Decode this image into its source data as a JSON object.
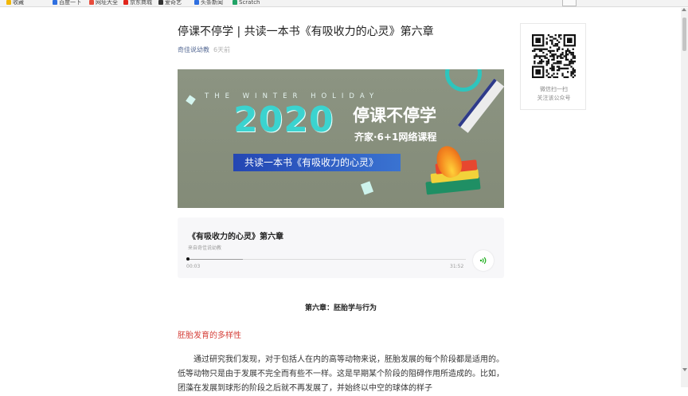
{
  "bookmarks": {
    "items": [
      {
        "label": "收藏",
        "color": "#f2b705"
      },
      {
        "label": "百度一下",
        "color": "#2f6fe0"
      },
      {
        "label": "网址大全",
        "color": "#e74c3c"
      },
      {
        "label": "京东商城",
        "color": "#e1251b"
      },
      {
        "label": "爱奇艺",
        "color": "#333333"
      },
      {
        "label": "头条新闻",
        "color": "#2f6fe0"
      },
      {
        "label": "Scratch",
        "color": "#21a366"
      }
    ]
  },
  "article": {
    "title": "停课不停学 | 共读一本书《有吸收力的心灵》第六章",
    "account": "奇佳说幼教",
    "time": "6天前"
  },
  "banner": {
    "winter_text": "THE WINTER HOLIDAY",
    "year": "2020",
    "slogan": "停课不停学",
    "course": "齐家·6+1网络课程",
    "ribbon": "共读一本书《有吸收力的心灵》"
  },
  "audio": {
    "title": "《有吸收力的心灵》第六章",
    "source": "来自奇佳说幼教",
    "current_time": "00:03",
    "duration": "31:52",
    "progress_fraction": 0.002
  },
  "content": {
    "chapter_heading": "第六章：胚胎学与行为",
    "section_heading": "胚胎发育的多样性",
    "paragraph": "通过研究我们发现，对于包括人在内的高等动物来说，胚胎发展的每个阶段都是适用的。低等动物只是由于发展不完全而有些不一样。这是早期某个阶段的阻碍作用所造成的。比如，团藻在发展到球形的阶段之后就不再发展了，并始终以中空的球体的样子"
  },
  "qr": {
    "line1": "微信扫一扫",
    "line2": "关注该公众号"
  },
  "colors": {
    "link_blue": "#576b95",
    "section_red": "#d5403a",
    "banner_teal": "#3bd3cf"
  }
}
